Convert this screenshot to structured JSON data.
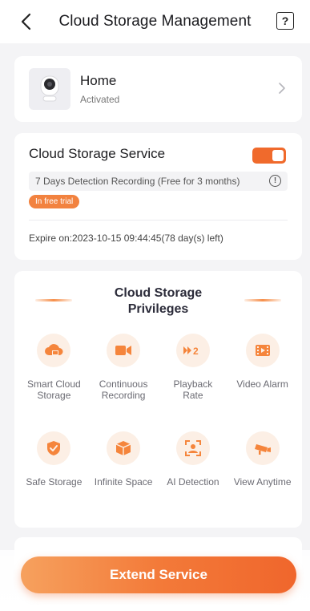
{
  "header": {
    "title": "Cloud Storage Management",
    "help_label": "?"
  },
  "device": {
    "name": "Home",
    "status": "Activated"
  },
  "service": {
    "title": "Cloud Storage Service",
    "enabled": true,
    "plan": "7 Days Detection Recording  (Free for 3 months)",
    "info_label": "!",
    "badge": "In free trial",
    "expire": "Expire on:2023-10-15 09:44:45(78 day(s) left)"
  },
  "privileges": {
    "title": "Cloud Storage Privileges",
    "items": [
      {
        "label": "Smart Cloud Storage",
        "icon": "cloud-storage-icon",
        "glyph": ""
      },
      {
        "label": "Continuous Recording",
        "icon": "video-camera-icon",
        "glyph": ""
      },
      {
        "label": "Playback Rate",
        "icon": "playback-rate-icon",
        "glyph": "▸▸2"
      },
      {
        "label": "Video Alarm",
        "icon": "video-alarm-icon",
        "glyph": ""
      },
      {
        "label": "Safe Storage",
        "icon": "shield-icon",
        "glyph": ""
      },
      {
        "label": "Infinite Space",
        "icon": "box-icon",
        "glyph": ""
      },
      {
        "label": "AI Detection",
        "icon": "ai-detection-icon",
        "glyph": ""
      },
      {
        "label": "View Anytime",
        "icon": "cctv-camera-icon",
        "glyph": ""
      }
    ]
  },
  "footer": {
    "button_label": "Extend Service"
  },
  "colors": {
    "accent": "#f06a2c",
    "icon_bg": "#fcefe5",
    "icon_fg": "#f5853c"
  }
}
